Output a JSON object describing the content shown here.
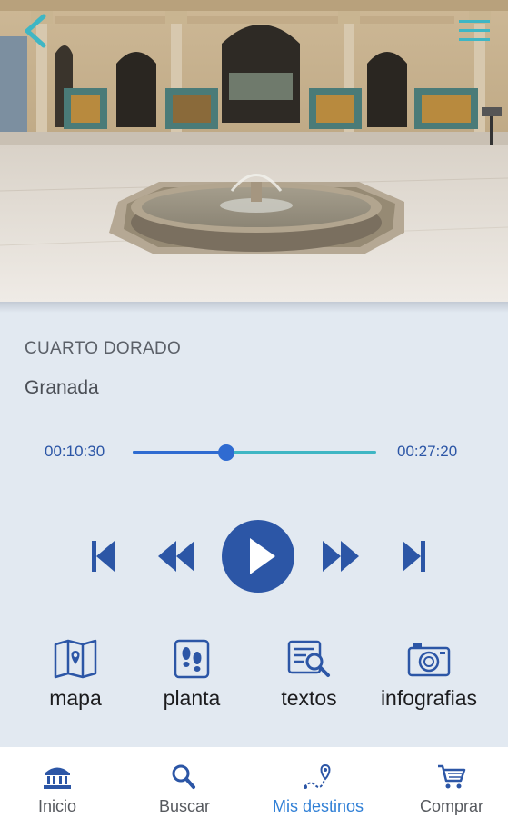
{
  "track": {
    "title": "CUARTO DORADO",
    "subtitle": "Granada"
  },
  "player": {
    "elapsed": "00:10:30",
    "total": "00:27:20",
    "progress_fraction": 0.384
  },
  "controls": {
    "icons": [
      "skip-previous-icon",
      "rewind-icon",
      "play-icon",
      "fast-forward-icon",
      "skip-next-icon"
    ]
  },
  "resources": [
    {
      "label": "mapa",
      "icon": "map-icon"
    },
    {
      "label": "planta",
      "icon": "footprints-icon"
    },
    {
      "label": "textos",
      "icon": "text-search-icon"
    },
    {
      "label": "infografias",
      "icon": "camera-icon"
    }
  ],
  "nav": [
    {
      "label": "Inicio",
      "icon": "monument-icon",
      "active": false
    },
    {
      "label": "Buscar",
      "icon": "search-icon",
      "active": false
    },
    {
      "label": "Mis destinos",
      "icon": "route-pin-icon",
      "active": true
    },
    {
      "label": "Comprar",
      "icon": "cart-icon",
      "active": false
    }
  ],
  "colors": {
    "accent": "#2c56a6",
    "progress_played": "#2f6bd1",
    "progress_remaining": "#3fb6c4",
    "nav_active": "#2f7fd6",
    "header_icons": "#3fb6c4",
    "panel_background": "#e2e9f1"
  }
}
